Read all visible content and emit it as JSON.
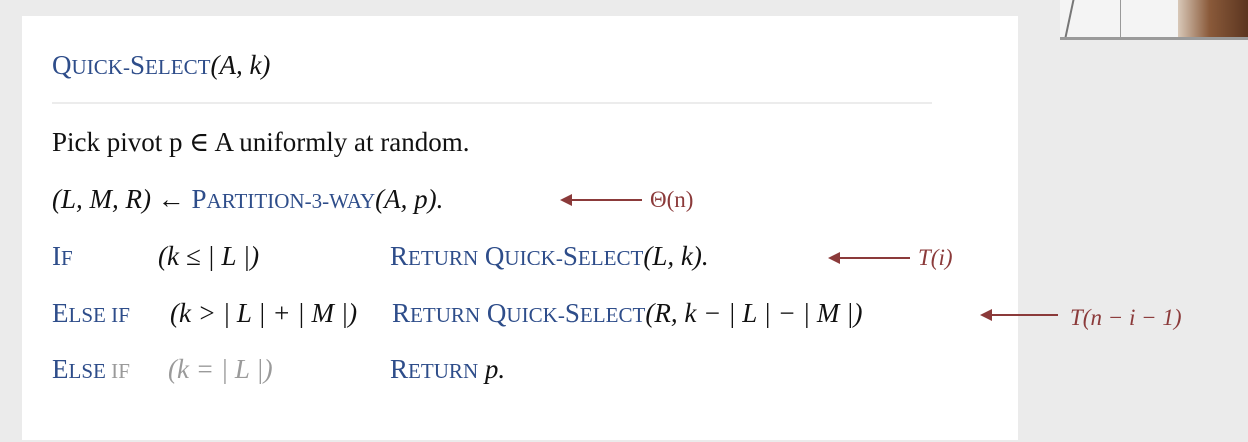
{
  "title": {
    "proc_first": "Q",
    "proc_rest": "UICK-",
    "proc_first2": "S",
    "proc_rest2": "ELECT",
    "args": "(A, k)"
  },
  "lines": {
    "pick": "Pick pivot p ∈ A uniformly at random.",
    "partition_lhs": "(L, M, R) ← ",
    "partition_p": "P",
    "partition_rest": "ARTITION-3-WAY",
    "partition_args": "(A, p).",
    "partition_cost": "Θ(n)"
  },
  "branches": [
    {
      "kw_first": "I",
      "kw_rest": "F",
      "cond": "(k  ≤  | L |)",
      "ret_first": "R",
      "ret_rest": "ETURN",
      "call_first": "Q",
      "call_rest": "UICK-",
      "call_first2": "S",
      "call_rest2": "ELECT",
      "call_args": "(L, k).",
      "cost": "T(i)"
    },
    {
      "kw_first": "E",
      "kw_rest": "LSE IF",
      "cond": "(k > | L | + | M |)",
      "ret_first": "R",
      "ret_rest": "ETURN",
      "call_first": "Q",
      "call_rest": "UICK-",
      "call_first2": "S",
      "call_rest2": "ELECT",
      "call_args": "(R, k − | L | − | M |)",
      "cost": "T(n − i − 1)"
    },
    {
      "kw_first": "E",
      "kw_rest": "LSE",
      "kw_tail": " IF",
      "cond": "(k  =  | L |)",
      "ret_first": "R",
      "ret_rest": "ETURN",
      "call_args": "p."
    }
  ],
  "colors": {
    "keyword_blue": "#2e4d8a",
    "annotation_red": "#8b3a3a",
    "text": "#111111",
    "faint": "#9a9a9a"
  }
}
